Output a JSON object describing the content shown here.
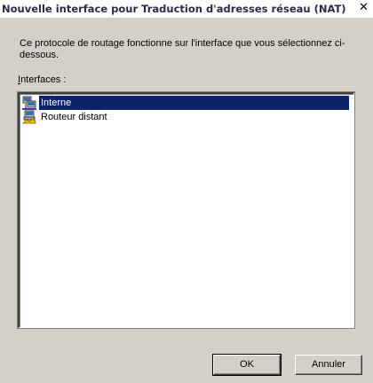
{
  "window": {
    "title": "Nouvelle interface pour Traduction d'adresses réseau (NAT)",
    "close_label": "✕"
  },
  "description": "Ce protocole de routage fonctionne sur l'interface que vous sélectionnez ci-dessous.",
  "interfaces": {
    "label_mnemonic": "I",
    "label_rest": "nterfaces :",
    "items": [
      {
        "label": "Interne",
        "icon": "lan-network-icon",
        "selected": true
      },
      {
        "label": "Routeur distant",
        "icon": "demand-dial-router-icon",
        "selected": false
      }
    ]
  },
  "buttons": {
    "ok_label": "OK",
    "cancel_label": "Annuler"
  },
  "colors": {
    "selection_bg": "#0a246a",
    "dialog_bg": "#d4d0c8"
  }
}
